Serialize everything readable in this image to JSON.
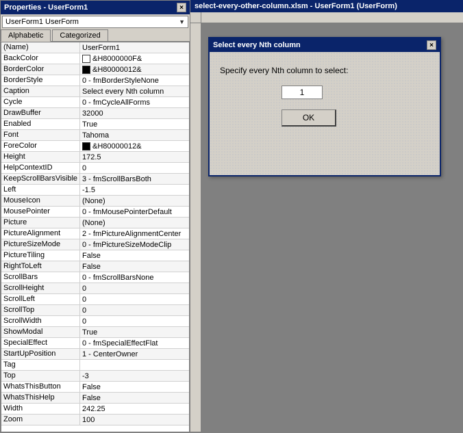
{
  "properties_panel": {
    "title": "Properties - UserForm1",
    "close_btn": "×",
    "dropdown": {
      "value": "UserForm1  UserForm",
      "arrow": "▼"
    },
    "tabs": [
      {
        "label": "Alphabetic",
        "active": true
      },
      {
        "label": "Categorized",
        "active": false
      }
    ],
    "rows": [
      {
        "name": "(Name)",
        "value": "UserForm1",
        "has_color": false,
        "color_type": ""
      },
      {
        "name": "BackColor",
        "value": "&H8000000F&",
        "has_color": true,
        "color_type": "white"
      },
      {
        "name": "BorderColor",
        "value": "&H80000012&",
        "has_color": true,
        "color_type": "black"
      },
      {
        "name": "BorderStyle",
        "value": "0 - fmBorderStyleNone",
        "has_color": false
      },
      {
        "name": "Caption",
        "value": "Select every Nth column",
        "has_color": false
      },
      {
        "name": "Cycle",
        "value": "0 - fmCycleAllForms",
        "has_color": false
      },
      {
        "name": "DrawBuffer",
        "value": "32000",
        "has_color": false
      },
      {
        "name": "Enabled",
        "value": "True",
        "has_color": false
      },
      {
        "name": "Font",
        "value": "Tahoma",
        "has_color": false
      },
      {
        "name": "ForeColor",
        "value": "&H80000012&",
        "has_color": true,
        "color_type": "black"
      },
      {
        "name": "Height",
        "value": "172.5",
        "has_color": false
      },
      {
        "name": "HelpContextID",
        "value": "0",
        "has_color": false
      },
      {
        "name": "KeepScrollBarsVisible",
        "value": "3 - fmScrollBarsBoth",
        "has_color": false
      },
      {
        "name": "Left",
        "value": "-1.5",
        "has_color": false
      },
      {
        "name": "MouseIcon",
        "value": "(None)",
        "has_color": false
      },
      {
        "name": "MousePointer",
        "value": "0 - fmMousePointerDefault",
        "has_color": false
      },
      {
        "name": "Picture",
        "value": "(None)",
        "has_color": false
      },
      {
        "name": "PictureAlignment",
        "value": "2 - fmPictureAlignmentCenter",
        "has_color": false
      },
      {
        "name": "PictureSizeMode",
        "value": "0 - fmPictureSizeModeClip",
        "has_color": false
      },
      {
        "name": "PictureTiling",
        "value": "False",
        "has_color": false
      },
      {
        "name": "RightToLeft",
        "value": "False",
        "has_color": false
      },
      {
        "name": "ScrollBars",
        "value": "0 - fmScrollBarsNone",
        "has_color": false
      },
      {
        "name": "ScrollHeight",
        "value": "0",
        "has_color": false
      },
      {
        "name": "ScrollLeft",
        "value": "0",
        "has_color": false
      },
      {
        "name": "ScrollTop",
        "value": "0",
        "has_color": false
      },
      {
        "name": "ScrollWidth",
        "value": "0",
        "has_color": false
      },
      {
        "name": "ShowModal",
        "value": "True",
        "has_color": false
      },
      {
        "name": "SpecialEffect",
        "value": "0 - fmSpecialEffectFlat",
        "has_color": false
      },
      {
        "name": "StartUpPosition",
        "value": "1 - CenterOwner",
        "has_color": false
      },
      {
        "name": "Tag",
        "value": "",
        "has_color": false
      },
      {
        "name": "Top",
        "value": "-3",
        "has_color": false
      },
      {
        "name": "WhatsThisButton",
        "value": "False",
        "has_color": false
      },
      {
        "name": "WhatsThisHelp",
        "value": "False",
        "has_color": false
      },
      {
        "name": "Width",
        "value": "242.25",
        "has_color": false
      },
      {
        "name": "Zoom",
        "value": "100",
        "has_color": false
      }
    ]
  },
  "vbe_panel": {
    "title": "select-every-other-column.xlsm - UserForm1 (UserForm)"
  },
  "dialog": {
    "title": "Select every Nth column",
    "close_btn": "×",
    "label": "Specify every Nth column to select:",
    "input_value": "1",
    "ok_button": "OK"
  }
}
